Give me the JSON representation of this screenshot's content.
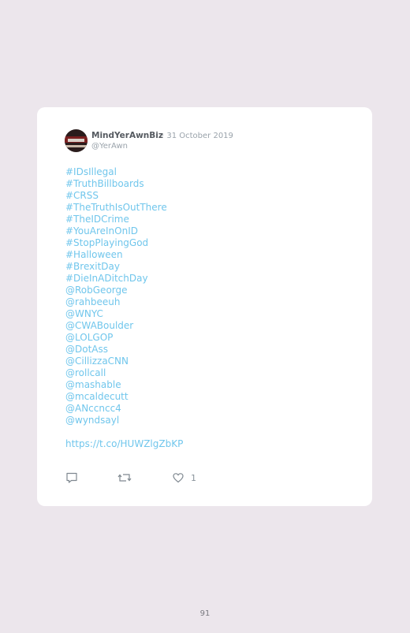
{
  "tweet": {
    "user_name": "MindYerAwnBiz",
    "date": "· 31 October 2019",
    "handle": "@YerAwn",
    "lines": [
      "#IDsIllegal",
      "#TruthBillboards",
      "#CRSS",
      "#TheTruthIsOutThere",
      "#TheIDCrime",
      "#YouAreInOnID",
      "#StopPlayingGod",
      "#Halloween",
      "#BrexitDay",
      "#DieInADitchDay",
      "@RobGeorge",
      "@rahbeeuh",
      "@WNYC",
      "@CWABoulder",
      "@LOLGOP",
      "@DotAss",
      "@CillizzaCNN",
      "@rollcall",
      "@mashable",
      "@mcaldecutt",
      "@ANccncc4",
      "@wyndsayl"
    ],
    "link": "https://t.co/HUWZlgZbKP",
    "likes": "1"
  },
  "icons": {
    "reply": "reply-icon",
    "retweet": "retweet-icon",
    "like": "heart-icon"
  },
  "colors": {
    "background": "#ece6ec",
    "card": "#ffffff",
    "link": "#70c6ec",
    "muted": "#9aa3ab"
  },
  "page": {
    "number": "91"
  }
}
